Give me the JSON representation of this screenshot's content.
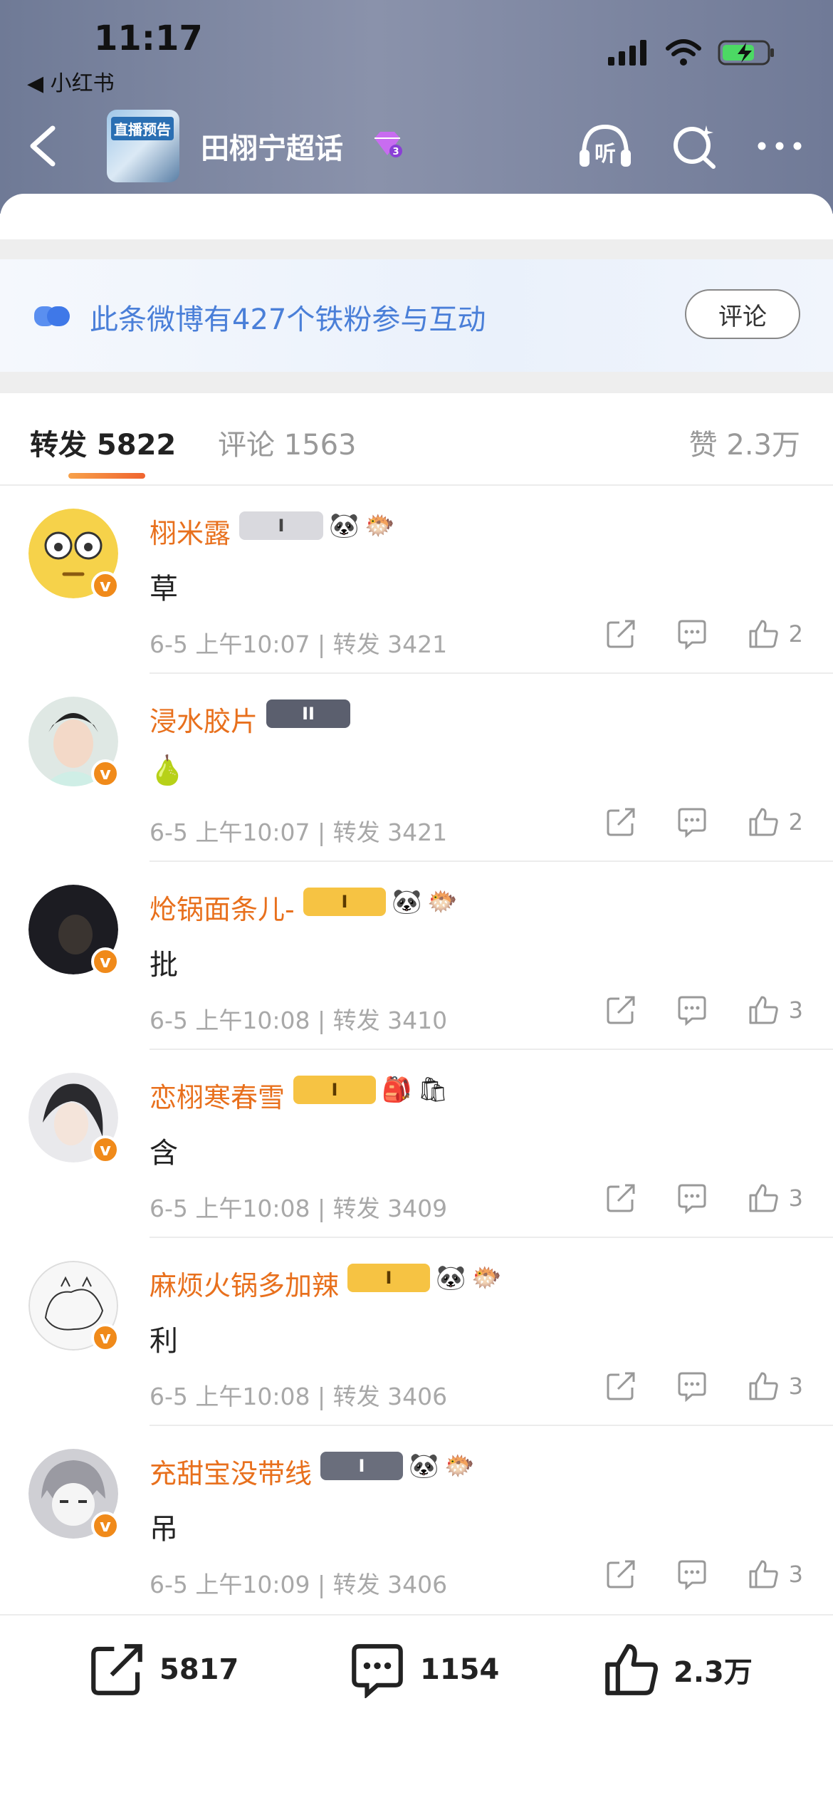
{
  "status": {
    "time": "11:17",
    "back_app": "◀ 小红书"
  },
  "header": {
    "title": "田栩宁超话",
    "avatar_text": "直播预告",
    "gem_level": "3",
    "listen_label": "听"
  },
  "banner": {
    "text": "此条微博有427个铁粉参与互动",
    "button": "评论"
  },
  "tabs": {
    "repost": "转发 5822",
    "comment": "评论 1563",
    "like": "赞 2.3万"
  },
  "items": [
    {
      "name": "栩米露",
      "content": "草",
      "meta": "6-5 上午10:07 | 转发 3421",
      "likes": "2",
      "badges": [
        "I",
        "熊猫",
        "鱼"
      ],
      "avatar_color": "#f6d24a"
    },
    {
      "name": "浸水胶片",
      "content": "🍐",
      "meta": "6-5 上午10:07 | 转发 3421",
      "likes": "2",
      "badges": [
        "II"
      ],
      "avatar_color": "#dfe8e4"
    },
    {
      "name": "炝锅面条儿-",
      "content": "批",
      "meta": "6-5 上午10:08 | 转发 3410",
      "likes": "3",
      "badges": [
        "I",
        "熊猫",
        "鱼"
      ],
      "avatar_color": "#1c1c22"
    },
    {
      "name": "恋栩寒春雪",
      "content": "含",
      "meta": "6-5 上午10:08 | 转发 3409",
      "likes": "3",
      "badges": [
        "I",
        "书包",
        "袋"
      ],
      "avatar_color": "#e9e9ec"
    },
    {
      "name": "麻烦火锅多加辣",
      "content": "利",
      "meta": "6-5 上午10:08 | 转发 3406",
      "likes": "3",
      "badges": [
        "I",
        "熊猫",
        "鱼"
      ],
      "avatar_color": "#f7f7f7"
    },
    {
      "name": "充甜宝没带线",
      "content": "吊",
      "meta": "6-5 上午10:09 | 转发 3406",
      "likes": "3",
      "badges": [
        "I",
        "熊猫",
        "鱼"
      ],
      "avatar_color": "#cfcfd4"
    }
  ],
  "bottom": {
    "repost": "5817",
    "comment": "1154",
    "like": "2.3万"
  },
  "colors": {
    "accent_orange": "#e8701d",
    "link_blue": "#4a7fd8",
    "verify_badge": "#f08a1a"
  }
}
